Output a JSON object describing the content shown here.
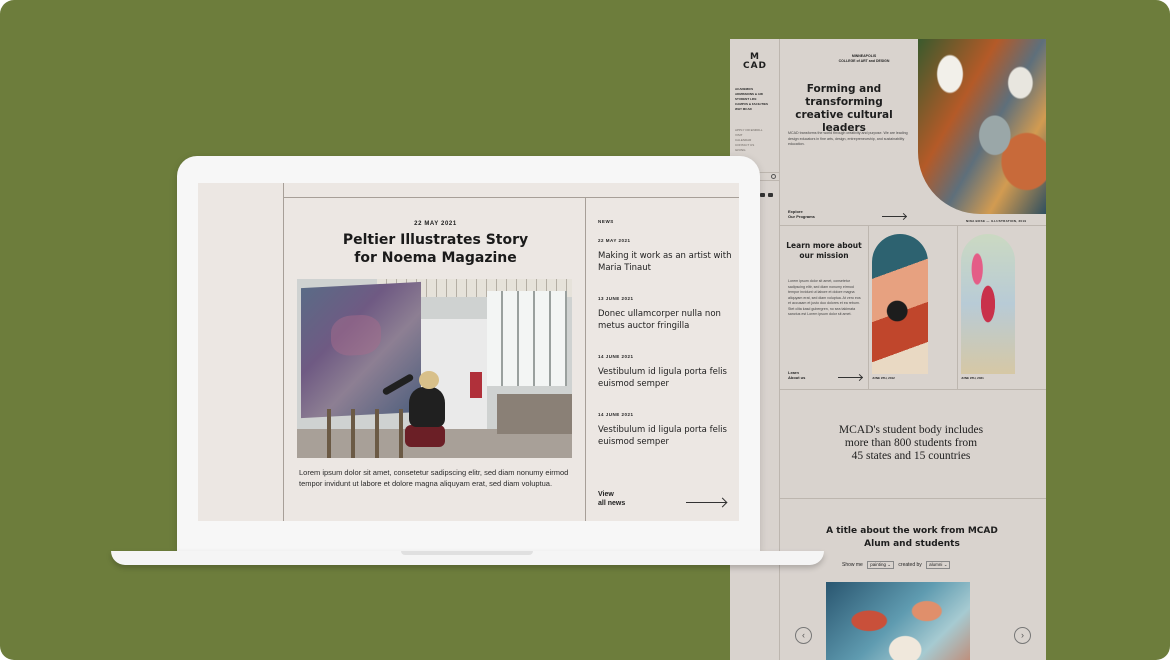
{
  "tall_page": {
    "logo": "M\nCAD",
    "college_name": "MINNEAPOLIS\nCOLLEGE of ART and DESIGN",
    "nav_primary": [
      "ACADEMICS",
      "ADMISSIONS & AID",
      "STUDENT LIFE",
      "CAMPUS & FACILITIES",
      "WHY MCAD"
    ],
    "nav_secondary": [
      "APPLY OR ENROLL",
      "VISIT",
      "CALENDAR",
      "CONTACT US",
      "GIVING"
    ],
    "hero": {
      "title": "Forming and transforming creative cultural leaders",
      "body": "MCAD transforms the world through creativity and purpose. We are leading design educators in fine arts, design, entrepreneurship, and sustainability education.",
      "cta": "Explore\nOur Programs",
      "image_caption": "NINA BOSE — ILLUSTRATION, 2019"
    },
    "mission": {
      "title": "Learn more about our mission",
      "body": "Lorem ipsum dolor sit amet, consetetur sadipscing elitr, sed diam nonumy eirmod tempor invidunt ut labore et dolore magna aliquyam erat, sed diam voluptua. At vero eos et accusam et justo duo dolores et ea rebum. Stet clita kasd gubergren, no sea takimata sanctus est Lorem ipsum dolor sit amet.",
      "cta": "Learn\nAbout us",
      "caption_1": "JUNE 9TH, 2012",
      "caption_2": "JUNE 9TH, 2021"
    },
    "stat": "MCAD's student body includes\nmore than 800 students from\n45 states and 15 countries",
    "work": {
      "title": "A title about the work from MCAD Alum and students",
      "show_me": "Show me",
      "filter_1": "painting",
      "created_by": "created by",
      "filter_2": "alumni"
    }
  },
  "laptop_screen": {
    "article": {
      "date": "22 MAY 2021",
      "title": "Peltier Illustrates Story\nfor Noema Magazine",
      "body": "Lorem ipsum dolor sit amet, consetetur sadipscing elitr, sed diam nonumy eirmod tempor invidunt ut labore et dolore magna aliquyam erat, sed diam voluptua."
    },
    "news_label": "NEWS",
    "news": [
      {
        "date": "22 MAY 2021",
        "headline": "Making it work as an artist with Maria Tinaut"
      },
      {
        "date": "13 JUNE 2021",
        "headline": "Donec ullamcorper nulla non metus auctor fringilla"
      },
      {
        "date": "14 JUNE 2021",
        "headline": "Vestibulum id ligula porta felis euismod semper"
      },
      {
        "date": "14 JUNE 2021",
        "headline": "Vestibulum id ligula porta felis euismod semper"
      }
    ],
    "view_all": "View\nall news"
  },
  "colors": {
    "background": "#6d7d3c",
    "page_bg": "#d9d3ce",
    "screen_bg": "#ece7e3",
    "laptop": "#f7f7f7"
  }
}
